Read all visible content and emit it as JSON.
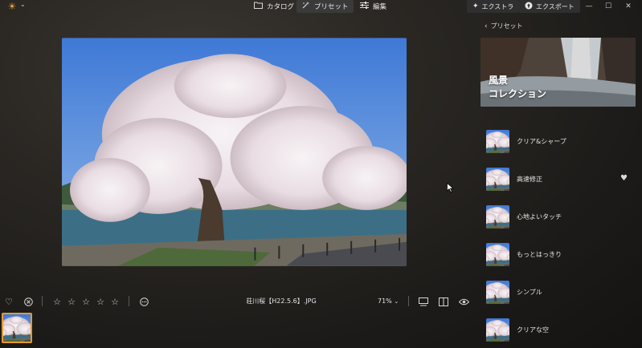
{
  "topbar": {
    "app_logo": "sun-logo",
    "tabs": [
      {
        "label": "カタログ",
        "icon": "folder-icon"
      },
      {
        "label": "プリセット",
        "icon": "sparkle-wand-icon"
      },
      {
        "label": "編集",
        "icon": "sliders-icon"
      }
    ],
    "active_tab": "プリセット",
    "buttons": [
      {
        "label": "エクストラ",
        "icon": "sparkle-icon"
      },
      {
        "label": "エクスポート",
        "icon": "upload-icon"
      }
    ],
    "window_controls": [
      "minimize",
      "maximize",
      "close"
    ]
  },
  "viewer": {
    "filename": "荘川桜【H22.5.6】.JPG",
    "zoom": "71%",
    "rating_stars": 5
  },
  "panel": {
    "back_label": "プリセット",
    "collection_title_line1": "風景",
    "collection_title_line2": "コレクション",
    "presets": [
      {
        "label": "クリア&シャープ",
        "favorite": false
      },
      {
        "label": "高速修正",
        "favorite": true
      },
      {
        "label": "心地よいタッチ",
        "favorite": false
      },
      {
        "label": "もっとはっきり",
        "favorite": false
      },
      {
        "label": "シンプル",
        "favorite": false
      },
      {
        "label": "クリアな空",
        "favorite": false
      }
    ]
  },
  "colors": {
    "accent": "#e69a2e",
    "active_tab_bg": "#3a3a3a"
  }
}
